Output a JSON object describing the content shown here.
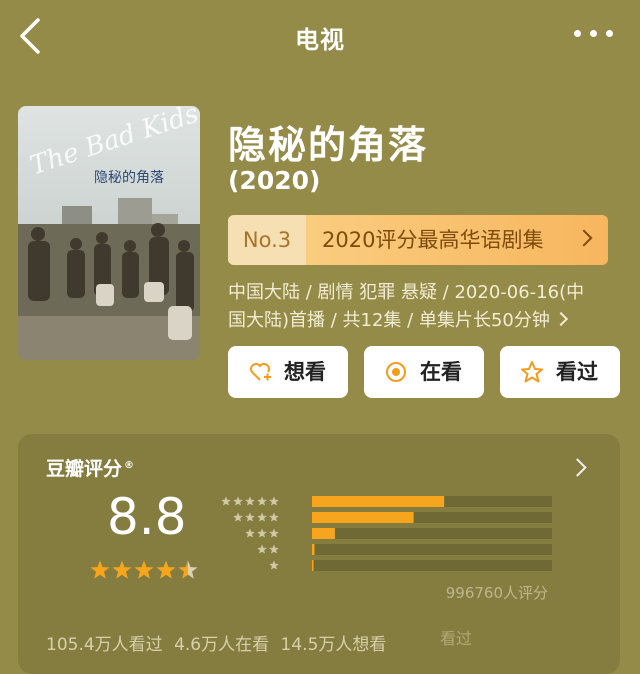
{
  "header": {
    "title": "电视"
  },
  "show": {
    "title": "隐秘的角落",
    "year": "(2020)",
    "rank_no": "No.3",
    "rank_text": "2020评分最高华语剧集",
    "meta_line1": "中国大陆 / 剧情 犯罪 悬疑 / 2020-06-16(中",
    "meta_line2": "国大陆)首播 / 共12集 / 单集片长50分钟"
  },
  "poster": {
    "script_text": "The Bad Kids",
    "chinese_text": "隐秘的角落"
  },
  "buttons": {
    "want": "想看",
    "watching": "在看",
    "watched": "看过"
  },
  "rating": {
    "label": "豆瓣评分",
    "registered": "®",
    "score": "8.8",
    "stars": 4.5,
    "distribution": [
      {
        "stars": 5,
        "fraction": 0.52
      },
      {
        "stars": 4,
        "fraction": 0.4
      },
      {
        "stars": 3,
        "fraction": 0.09
      },
      {
        "stars": 2,
        "fraction": 0.01
      },
      {
        "stars": 1,
        "fraction": 0.005
      }
    ],
    "votes": "996760人评分"
  },
  "stats": {
    "watched": "105.4万人看过",
    "watching": "4.6万人在看",
    "want": "14.5万人想看",
    "watermark": "看过"
  },
  "colors": {
    "background": "#948b49",
    "card": "#857d40",
    "rank_bg": "#f7b65e",
    "bar_fill": "#f7a51c",
    "bar_track": "#6f6a35",
    "star": "#f7a51c"
  }
}
